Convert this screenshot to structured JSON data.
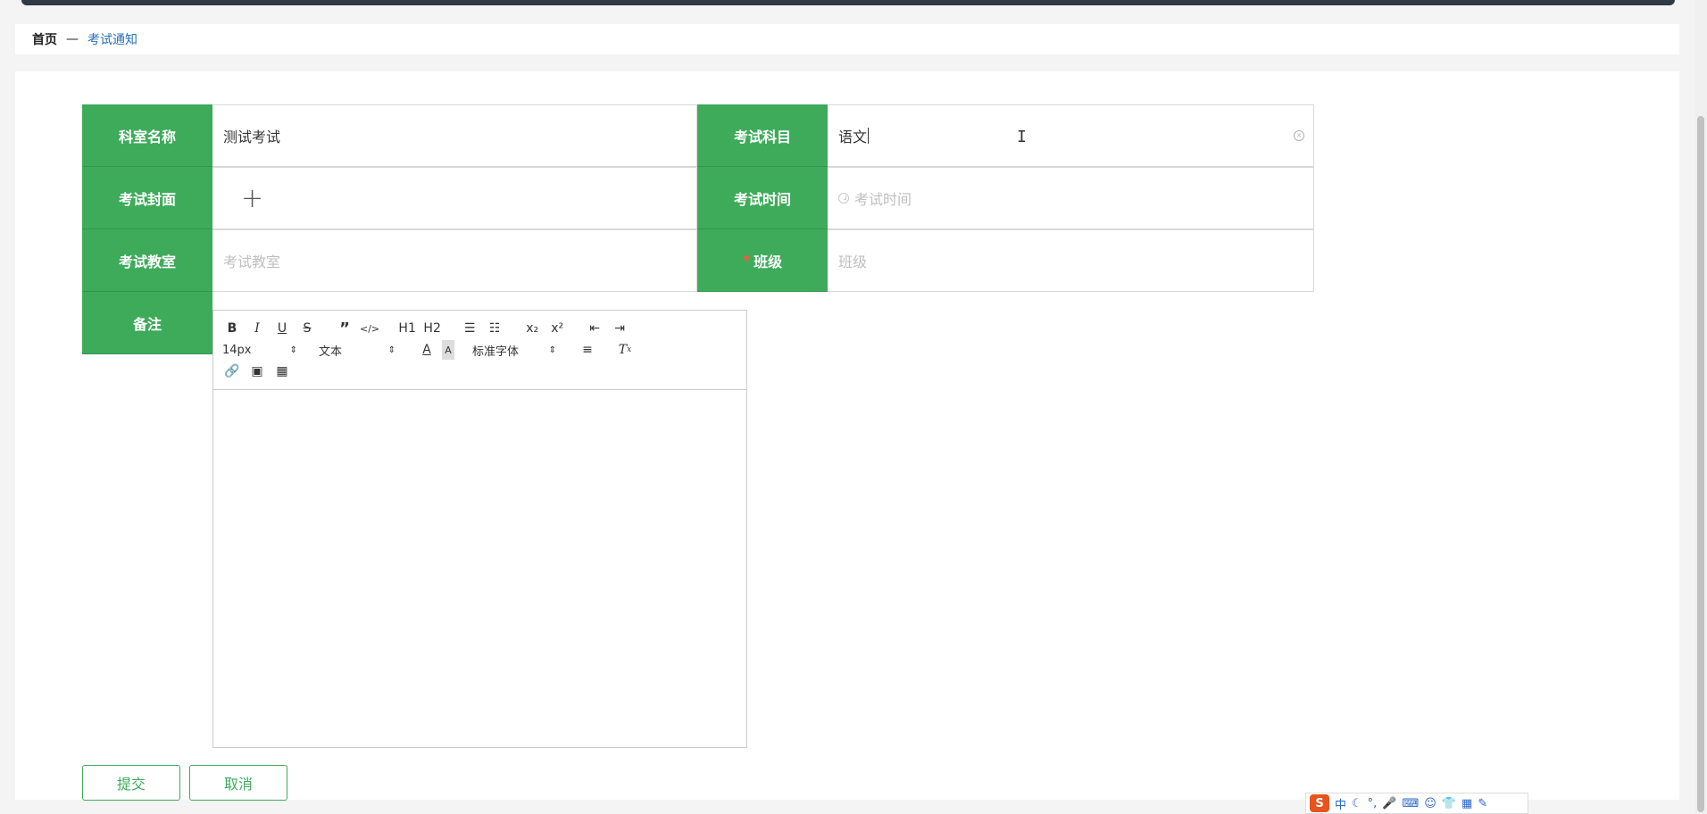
{
  "breadcrumb": {
    "home": "首页",
    "separator": "—",
    "current": "考试通知"
  },
  "form": {
    "dept_label": "科室名称",
    "dept_value": "测试考试",
    "subject_label": "考试科目",
    "subject_value": "语文",
    "cover_label": "考试封面",
    "cover_plus": "+",
    "time_label": "考试时间",
    "time_placeholder": "考试时间",
    "room_label": "考试教室",
    "room_placeholder": "考试教室",
    "class_label": "班级",
    "class_required": "*",
    "class_placeholder": "班级",
    "note_label": "备注"
  },
  "editor": {
    "font_size": "14px",
    "text_style": "文本",
    "font_family": "标准字体",
    "h1": "H1",
    "h2": "H2"
  },
  "actions": {
    "submit": "提交",
    "cancel": "取消"
  },
  "ime": {
    "logo": "S",
    "mode": "中"
  },
  "colors": {
    "accent": "#3eab5b",
    "link": "#2a6fb8",
    "required": "#f25a3a"
  }
}
